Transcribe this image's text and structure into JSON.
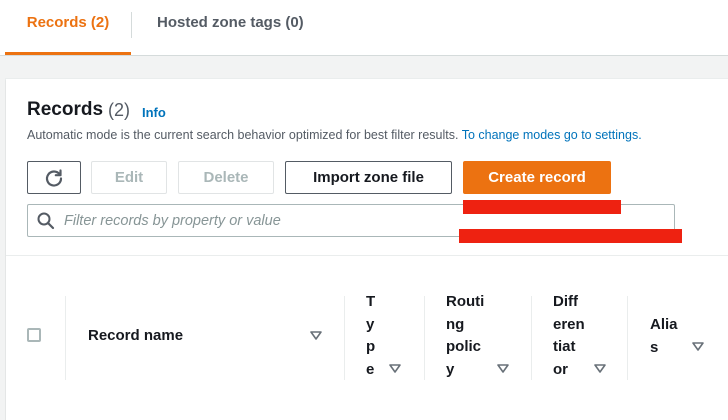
{
  "tabs": [
    {
      "label": "Records (2)",
      "active": true
    },
    {
      "label": "Hosted zone tags (0)",
      "active": false
    }
  ],
  "panel": {
    "title": "Records",
    "count": "(2)",
    "info_label": "Info",
    "description_text": "Automatic mode is the current search behavior optimized for best filter results. ",
    "description_link": "To change modes go to settings."
  },
  "toolbar": {
    "edit_label": "Edit",
    "delete_label": "Delete",
    "import_label": "Import zone file",
    "create_label": "Create record"
  },
  "search": {
    "placeholder": "Filter records by property or value",
    "value": ""
  },
  "table": {
    "columns": [
      {
        "label": "Record name"
      },
      {
        "label": "T\ny\np\ne"
      },
      {
        "label": "Routi\nng\npolic\ny"
      },
      {
        "label": "Diff\neren\ntiat\nor"
      },
      {
        "label": "Alia\ns"
      }
    ]
  },
  "colors": {
    "accent": "#ec7211",
    "link": "#0073bb",
    "redaction": "#ee2211"
  },
  "icons": [
    "refresh-icon",
    "search-icon",
    "sort-down-icon"
  ]
}
